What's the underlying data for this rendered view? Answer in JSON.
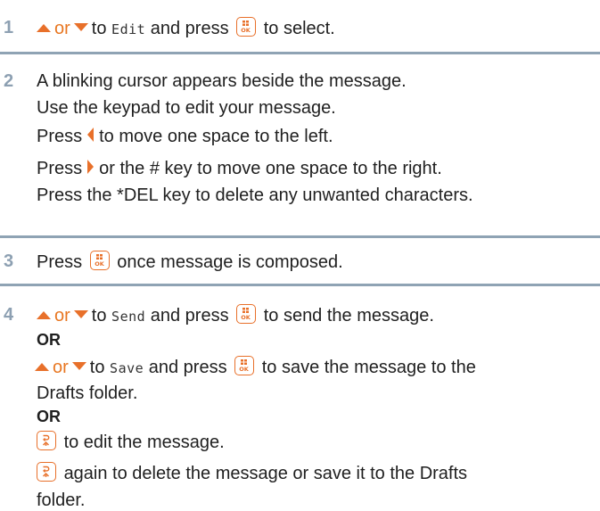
{
  "steps": [
    {
      "number": "1",
      "lines": [
        {
          "t1": "or",
          "t2": "to",
          "lcd": "Edit",
          "t3": "and press",
          "t4": "to select."
        }
      ]
    },
    {
      "number": "2",
      "lines": [
        "A blinking cursor appears beside the message.",
        "Use the keypad to edit your message.",
        {
          "p1": "Press",
          "p2": "to move one space to the left."
        },
        {
          "p1": "Press",
          "p2": "or the # key to move one space to the right."
        },
        "Press the *DEL key to delete any unwanted characters."
      ]
    },
    {
      "number": "3",
      "lines": [
        {
          "p1": "Press",
          "p2": "once message is composed."
        }
      ]
    },
    {
      "number": "4",
      "send_line": {
        "t1": "or",
        "t2": "to",
        "lcd": "Send",
        "t3": "and press",
        "t4": "to send the message."
      },
      "or1": "OR",
      "save_line": {
        "t1": "or",
        "t2": "to",
        "lcd": "Save",
        "t3": "and press",
        "t4": "to save the message to the"
      },
      "save_line2": "Drafts folder.",
      "or2": "OR",
      "back_line1": "to edit the message.",
      "back_line2a": "again to delete the message or save it to the Drafts",
      "back_line2b": "folder."
    }
  ],
  "icons": {
    "up": "up-arrow-icon",
    "down": "down-arrow-icon",
    "left": "left-arrow-icon",
    "right": "right-arrow-icon",
    "ok": "menu-ok-key-icon",
    "back": "back-key-icon"
  },
  "colors": {
    "accent": "#e8702a",
    "step_number": "#8da0b2",
    "rule": "#8fa3b4",
    "text": "#1f1f1f"
  }
}
